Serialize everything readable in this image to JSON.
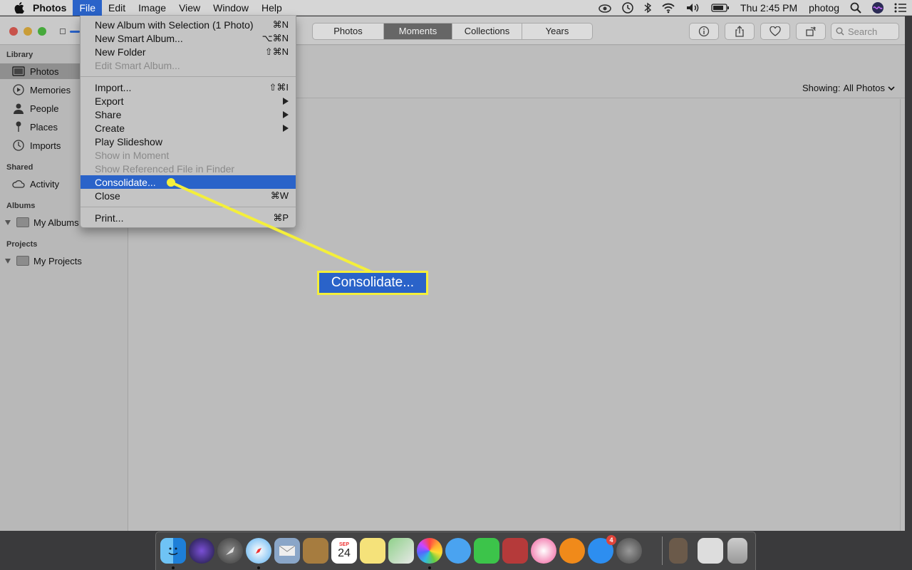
{
  "menubar": {
    "app_name": "Photos",
    "menus": [
      "File",
      "Edit",
      "Image",
      "View",
      "Window",
      "Help"
    ],
    "clock": "Thu 2:45 PM",
    "user": "photog"
  },
  "toolbar": {
    "segments": [
      "Photos",
      "Moments",
      "Collections",
      "Years"
    ],
    "selected_segment": "Moments",
    "search_placeholder": "Search"
  },
  "sidebar": {
    "sections": {
      "library": "Library",
      "shared": "Shared",
      "albums": "Albums",
      "projects": "Projects"
    },
    "items": {
      "photos": "Photos",
      "memories": "Memories",
      "people": "People",
      "places": "Places",
      "imports": "Imports",
      "activity": "Activity",
      "my_albums": "My Albums",
      "my_projects": "My Projects"
    }
  },
  "main": {
    "showing_label": "Showing:",
    "showing_value": "All Photos"
  },
  "file_menu": {
    "items": [
      {
        "label": "New Album with Selection (1 Photo)",
        "shortcut": "⌘N"
      },
      {
        "label": "New Smart Album...",
        "shortcut": "⌥⌘N"
      },
      {
        "label": "New Folder",
        "shortcut": "⇧⌘N"
      },
      {
        "label": "Edit Smart Album...",
        "shortcut": ""
      },
      {
        "label": "Import...",
        "shortcut": "⇧⌘I"
      },
      {
        "label": "Export",
        "shortcut": ""
      },
      {
        "label": "Share",
        "shortcut": ""
      },
      {
        "label": "Create",
        "shortcut": ""
      },
      {
        "label": "Play Slideshow",
        "shortcut": ""
      },
      {
        "label": "Show in Moment",
        "shortcut": ""
      },
      {
        "label": "Show Referenced File in Finder",
        "shortcut": ""
      },
      {
        "label": "Consolidate...",
        "shortcut": ""
      },
      {
        "label": "Close",
        "shortcut": "⌘W"
      },
      {
        "label": "Print...",
        "shortcut": "⌘P"
      }
    ]
  },
  "callout": {
    "label": "Consolidate..."
  },
  "dock": {
    "calendar_month": "SEP",
    "calendar_day": "24",
    "appstore_badge": "4"
  },
  "colors": {
    "accent": "#2a63c9",
    "callout_border": "#f4ef3b"
  }
}
